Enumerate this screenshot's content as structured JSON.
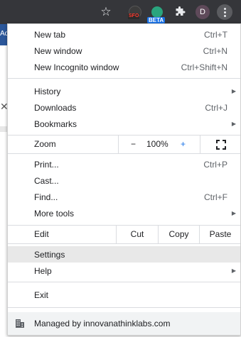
{
  "tab": {
    "partial_title": "Ad"
  },
  "toolbar": {
    "star_icon": "star-outline-icon",
    "sfo_label": "SFO",
    "beta_label": "BETA",
    "extensions_icon": "puzzle-icon",
    "avatar_initial": "D",
    "menu_icon": "kebab-menu-icon",
    "background_color": "#35363a"
  },
  "menu": {
    "new_tab": {
      "label": "New tab",
      "shortcut": "Ctrl+T"
    },
    "new_window": {
      "label": "New window",
      "shortcut": "Ctrl+N"
    },
    "new_incognito": {
      "label": "New Incognito window",
      "shortcut": "Ctrl+Shift+N"
    },
    "history": {
      "label": "History"
    },
    "downloads": {
      "label": "Downloads",
      "shortcut": "Ctrl+J"
    },
    "bookmarks": {
      "label": "Bookmarks"
    },
    "zoom": {
      "label": "Zoom",
      "minus": "−",
      "value": "100%",
      "plus": "+"
    },
    "print": {
      "label": "Print...",
      "shortcut": "Ctrl+P"
    },
    "cast": {
      "label": "Cast..."
    },
    "find": {
      "label": "Find...",
      "shortcut": "Ctrl+F"
    },
    "more_tools": {
      "label": "More tools"
    },
    "edit": {
      "label": "Edit",
      "cut": "Cut",
      "copy": "Copy",
      "paste": "Paste"
    },
    "settings": {
      "label": "Settings"
    },
    "help": {
      "label": "Help"
    },
    "exit": {
      "label": "Exit"
    },
    "managed": {
      "label": "Managed by innovanathinklabs.com"
    }
  },
  "colors": {
    "highlight": "#e8e8e8",
    "separator": "#dadce0",
    "managed_bg": "#f1f3f4",
    "beta_green": "#2aa57e",
    "sfo_red": "#ff3b30"
  }
}
